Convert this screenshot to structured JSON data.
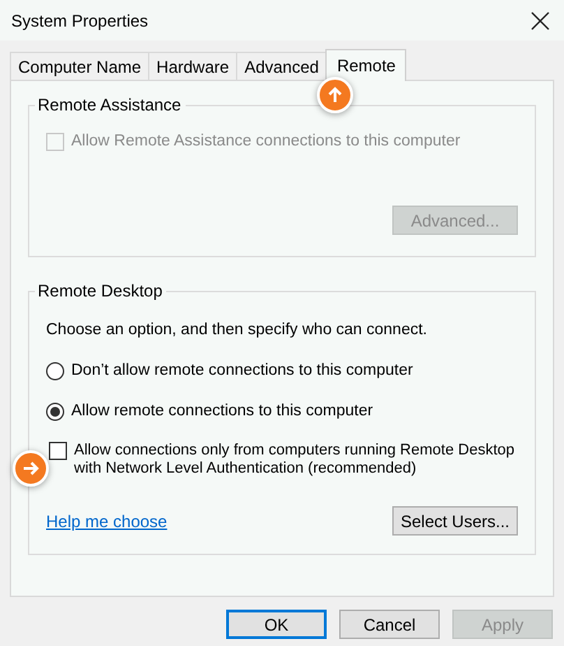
{
  "window": {
    "title": "System Properties"
  },
  "tabs": [
    {
      "label": "Computer Name",
      "selected": false
    },
    {
      "label": "Hardware",
      "selected": false
    },
    {
      "label": "Advanced",
      "selected": false
    },
    {
      "label": "Remote",
      "selected": true
    }
  ],
  "remote_assistance": {
    "title": "Remote Assistance",
    "checkbox": {
      "label": "Allow Remote Assistance connections to this computer",
      "checked": false,
      "disabled": true
    },
    "advanced_button": {
      "label": "Advanced...",
      "disabled": true
    }
  },
  "remote_desktop": {
    "title": "Remote Desktop",
    "instruction": "Choose an option, and then specify who can connect.",
    "options": [
      {
        "label": "Don’t allow remote connections to this computer",
        "selected": false
      },
      {
        "label": "Allow remote connections to this computer",
        "selected": true
      }
    ],
    "nla_checkbox": {
      "label": "Allow connections only from computers running Remote Desktop with Network Level Authentication (recommended)",
      "checked": false,
      "disabled": false
    },
    "help_link": "Help me choose",
    "select_users_button": {
      "label": "Select Users...",
      "disabled": false
    }
  },
  "buttons": [
    {
      "label": "OK",
      "default": true,
      "disabled": false
    },
    {
      "label": "Cancel",
      "default": false,
      "disabled": false
    },
    {
      "label": "Apply",
      "default": false,
      "disabled": true
    }
  ]
}
